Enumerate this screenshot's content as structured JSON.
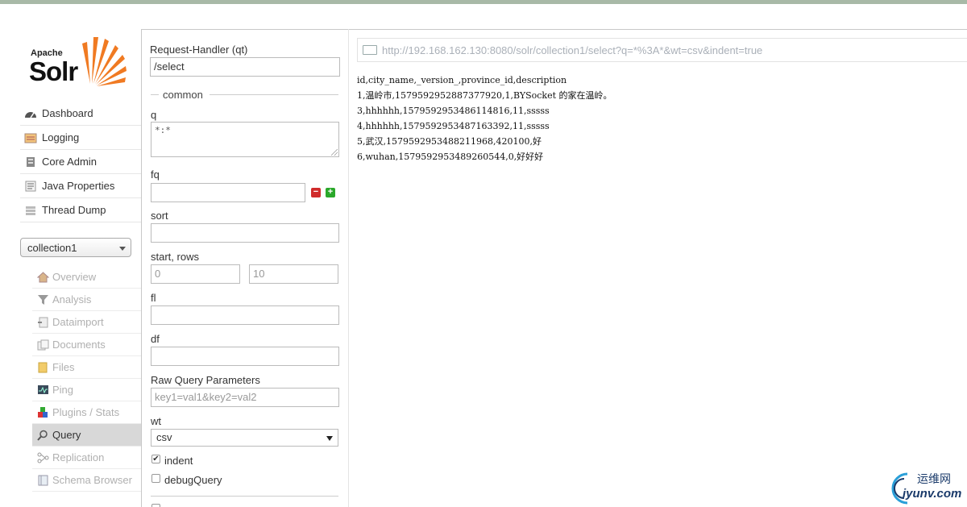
{
  "logo": {
    "apache": "Apache",
    "solr": "Solr"
  },
  "nav": [
    {
      "label": "Dashboard",
      "icon": "dashboard-icon"
    },
    {
      "label": "Logging",
      "icon": "logging-icon"
    },
    {
      "label": "Core Admin",
      "icon": "core-admin-icon"
    },
    {
      "label": "Java Properties",
      "icon": "java-properties-icon"
    },
    {
      "label": "Thread Dump",
      "icon": "thread-dump-icon"
    }
  ],
  "core_selector": {
    "value": "collection1"
  },
  "core_nav": [
    {
      "label": "Overview",
      "icon": "home-icon"
    },
    {
      "label": "Analysis",
      "icon": "funnel-icon"
    },
    {
      "label": "Dataimport",
      "icon": "dataimport-icon"
    },
    {
      "label": "Documents",
      "icon": "documents-icon"
    },
    {
      "label": "Files",
      "icon": "folder-icon"
    },
    {
      "label": "Ping",
      "icon": "ping-icon"
    },
    {
      "label": "Plugins / Stats",
      "icon": "plugins-icon"
    },
    {
      "label": "Query",
      "icon": "magnifier-icon",
      "active": true
    },
    {
      "label": "Replication",
      "icon": "replication-icon"
    },
    {
      "label": "Schema Browser",
      "icon": "schema-icon"
    }
  ],
  "form": {
    "handler_label": "Request-Handler (qt)",
    "handler_value": "/select",
    "common_label": "common",
    "q_label": "q",
    "q_value": "*:*",
    "fq_label": "fq",
    "sort_label": "sort",
    "start_rows_label": "start, rows",
    "start_value": "0",
    "rows_value": "10",
    "fl_label": "fl",
    "df_label": "df",
    "raw_label": "Raw Query Parameters",
    "raw_placeholder": "key1=val1&key2=val2",
    "wt_label": "wt",
    "wt_value": "csv",
    "indent_label": "indent",
    "debug_label": "debugQuery"
  },
  "results": {
    "url": "http://192.168.162.130:8080/solr/collection1/select?q=*%3A*&wt=csv&indent=true",
    "lines": [
      "id,city_name,_version_,province_id,description",
      "1,温岭市,1579592952887377920,1,BYSocket 的家在温岭。",
      "3,hhhhhh,1579592953486114816,11,sssss",
      "4,hhhhhh,1579592953487163392,11,sssss",
      "5,武汉,1579592953488211968,420100,好",
      "6,wuhan,1579592953489260544,0,好好好"
    ]
  },
  "watermark": {
    "cn": "运维网",
    "en": "iyunv.com"
  },
  "colors": {
    "accent_orange": "#f07a22",
    "active_bg": "#d8d8d8",
    "topbar": "#a8b9a7"
  }
}
